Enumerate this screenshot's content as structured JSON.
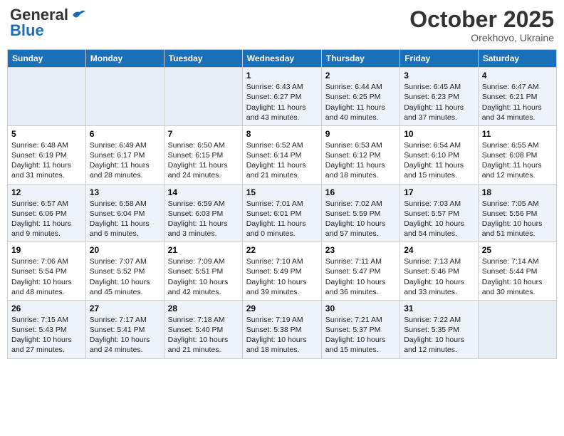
{
  "header": {
    "logo_general": "General",
    "logo_blue": "Blue",
    "month": "October 2025",
    "location": "Orekhovo, Ukraine"
  },
  "weekdays": [
    "Sunday",
    "Monday",
    "Tuesday",
    "Wednesday",
    "Thursday",
    "Friday",
    "Saturday"
  ],
  "weeks": [
    [
      {
        "day": "",
        "info": ""
      },
      {
        "day": "",
        "info": ""
      },
      {
        "day": "",
        "info": ""
      },
      {
        "day": "1",
        "info": "Sunrise: 6:43 AM\nSunset: 6:27 PM\nDaylight: 11 hours\nand 43 minutes."
      },
      {
        "day": "2",
        "info": "Sunrise: 6:44 AM\nSunset: 6:25 PM\nDaylight: 11 hours\nand 40 minutes."
      },
      {
        "day": "3",
        "info": "Sunrise: 6:45 AM\nSunset: 6:23 PM\nDaylight: 11 hours\nand 37 minutes."
      },
      {
        "day": "4",
        "info": "Sunrise: 6:47 AM\nSunset: 6:21 PM\nDaylight: 11 hours\nand 34 minutes."
      }
    ],
    [
      {
        "day": "5",
        "info": "Sunrise: 6:48 AM\nSunset: 6:19 PM\nDaylight: 11 hours\nand 31 minutes."
      },
      {
        "day": "6",
        "info": "Sunrise: 6:49 AM\nSunset: 6:17 PM\nDaylight: 11 hours\nand 28 minutes."
      },
      {
        "day": "7",
        "info": "Sunrise: 6:50 AM\nSunset: 6:15 PM\nDaylight: 11 hours\nand 24 minutes."
      },
      {
        "day": "8",
        "info": "Sunrise: 6:52 AM\nSunset: 6:14 PM\nDaylight: 11 hours\nand 21 minutes."
      },
      {
        "day": "9",
        "info": "Sunrise: 6:53 AM\nSunset: 6:12 PM\nDaylight: 11 hours\nand 18 minutes."
      },
      {
        "day": "10",
        "info": "Sunrise: 6:54 AM\nSunset: 6:10 PM\nDaylight: 11 hours\nand 15 minutes."
      },
      {
        "day": "11",
        "info": "Sunrise: 6:55 AM\nSunset: 6:08 PM\nDaylight: 11 hours\nand 12 minutes."
      }
    ],
    [
      {
        "day": "12",
        "info": "Sunrise: 6:57 AM\nSunset: 6:06 PM\nDaylight: 11 hours\nand 9 minutes."
      },
      {
        "day": "13",
        "info": "Sunrise: 6:58 AM\nSunset: 6:04 PM\nDaylight: 11 hours\nand 6 minutes."
      },
      {
        "day": "14",
        "info": "Sunrise: 6:59 AM\nSunset: 6:03 PM\nDaylight: 11 hours\nand 3 minutes."
      },
      {
        "day": "15",
        "info": "Sunrise: 7:01 AM\nSunset: 6:01 PM\nDaylight: 11 hours\nand 0 minutes."
      },
      {
        "day": "16",
        "info": "Sunrise: 7:02 AM\nSunset: 5:59 PM\nDaylight: 10 hours\nand 57 minutes."
      },
      {
        "day": "17",
        "info": "Sunrise: 7:03 AM\nSunset: 5:57 PM\nDaylight: 10 hours\nand 54 minutes."
      },
      {
        "day": "18",
        "info": "Sunrise: 7:05 AM\nSunset: 5:56 PM\nDaylight: 10 hours\nand 51 minutes."
      }
    ],
    [
      {
        "day": "19",
        "info": "Sunrise: 7:06 AM\nSunset: 5:54 PM\nDaylight: 10 hours\nand 48 minutes."
      },
      {
        "day": "20",
        "info": "Sunrise: 7:07 AM\nSunset: 5:52 PM\nDaylight: 10 hours\nand 45 minutes."
      },
      {
        "day": "21",
        "info": "Sunrise: 7:09 AM\nSunset: 5:51 PM\nDaylight: 10 hours\nand 42 minutes."
      },
      {
        "day": "22",
        "info": "Sunrise: 7:10 AM\nSunset: 5:49 PM\nDaylight: 10 hours\nand 39 minutes."
      },
      {
        "day": "23",
        "info": "Sunrise: 7:11 AM\nSunset: 5:47 PM\nDaylight: 10 hours\nand 36 minutes."
      },
      {
        "day": "24",
        "info": "Sunrise: 7:13 AM\nSunset: 5:46 PM\nDaylight: 10 hours\nand 33 minutes."
      },
      {
        "day": "25",
        "info": "Sunrise: 7:14 AM\nSunset: 5:44 PM\nDaylight: 10 hours\nand 30 minutes."
      }
    ],
    [
      {
        "day": "26",
        "info": "Sunrise: 7:15 AM\nSunset: 5:43 PM\nDaylight: 10 hours\nand 27 minutes."
      },
      {
        "day": "27",
        "info": "Sunrise: 7:17 AM\nSunset: 5:41 PM\nDaylight: 10 hours\nand 24 minutes."
      },
      {
        "day": "28",
        "info": "Sunrise: 7:18 AM\nSunset: 5:40 PM\nDaylight: 10 hours\nand 21 minutes."
      },
      {
        "day": "29",
        "info": "Sunrise: 7:19 AM\nSunset: 5:38 PM\nDaylight: 10 hours\nand 18 minutes."
      },
      {
        "day": "30",
        "info": "Sunrise: 7:21 AM\nSunset: 5:37 PM\nDaylight: 10 hours\nand 15 minutes."
      },
      {
        "day": "31",
        "info": "Sunrise: 7:22 AM\nSunset: 5:35 PM\nDaylight: 10 hours\nand 12 minutes."
      },
      {
        "day": "",
        "info": ""
      }
    ]
  ]
}
